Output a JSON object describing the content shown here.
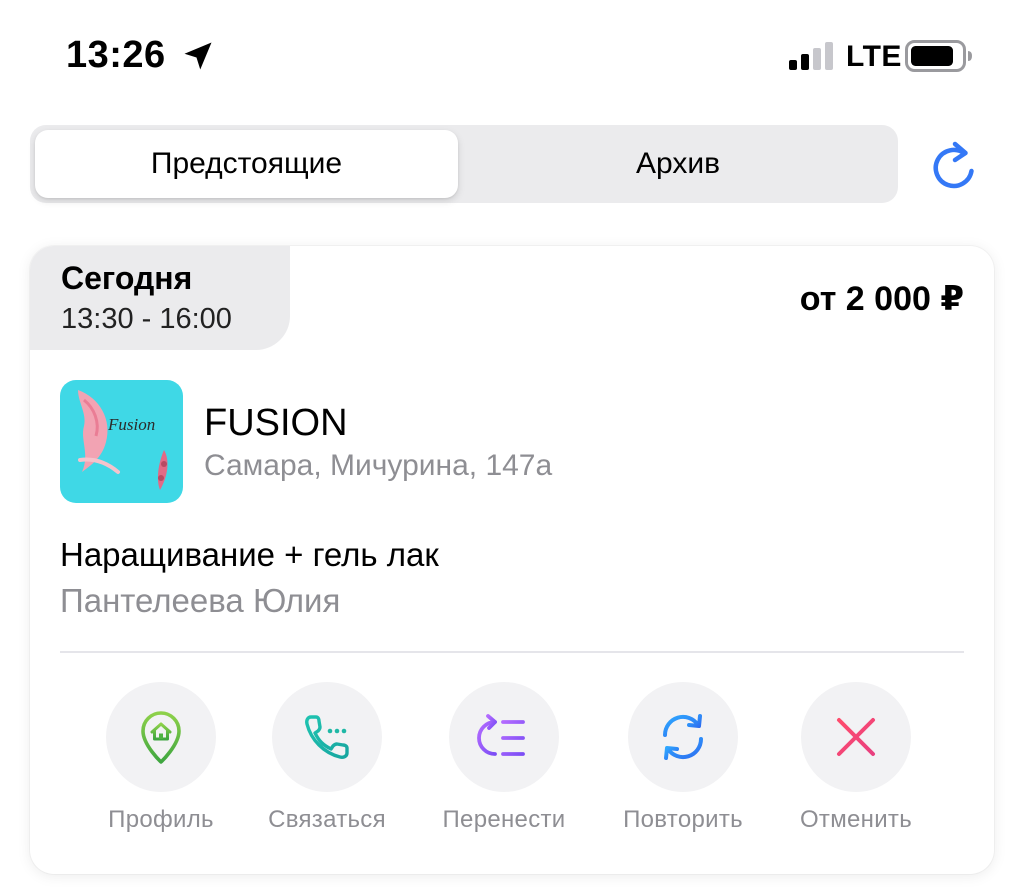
{
  "status_bar": {
    "time": "13:26",
    "network": "LTE",
    "icons": [
      "location-arrow-icon",
      "signal-icon",
      "battery-icon"
    ]
  },
  "tabs": {
    "upcoming": "Предстоящие",
    "archive": "Архив",
    "active": "upcoming",
    "refresh_icon": "refresh-icon"
  },
  "appointment": {
    "day": "Сегодня",
    "time_range": "13:30 - 16:00",
    "price": "от 2 000 ₽",
    "salon": {
      "name": "FUSION",
      "address": "Самара, Мичурина, 147а",
      "logo_text": "Fusion"
    },
    "service": "Наращивание + гель лак",
    "master": "Пантелеева Юлия",
    "actions": [
      {
        "label": "Профиль",
        "icon": "home-pin-icon",
        "color": "#6cbf3c"
      },
      {
        "label": "Связаться",
        "icon": "phone-icon",
        "color": "#1fb8a0"
      },
      {
        "label": "Перенести",
        "icon": "reschedule-icon",
        "color": "#8b5cf6"
      },
      {
        "label": "Повторить",
        "icon": "repeat-icon",
        "color": "#2f7ff0"
      },
      {
        "label": "Отменить",
        "icon": "close-icon",
        "color": "#f0407a"
      }
    ]
  },
  "colors": {
    "accent": "#3478f6",
    "secondary_text": "#8e8e93",
    "segment_bg": "#ebebed"
  }
}
